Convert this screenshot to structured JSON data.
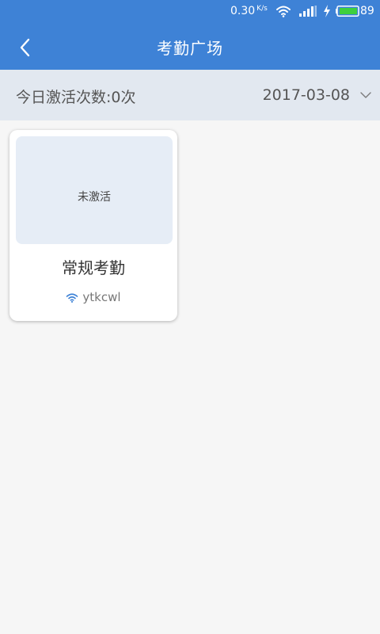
{
  "status_bar": {
    "speed": "0.30",
    "speed_unit": "K/s",
    "battery": "89",
    "icons": [
      "wifi-icon",
      "signal-icon",
      "charging-icon",
      "battery-icon"
    ]
  },
  "header": {
    "title": "考勤广场",
    "back_icon": "chevron-left-icon"
  },
  "filter": {
    "activation_count_label": "今日激活次数:0次",
    "date": "2017-03-08",
    "dropdown_icon": "chevron-down-icon"
  },
  "cards": [
    {
      "status": "未激活",
      "title": "常规考勤",
      "wifi_icon": "wifi-icon",
      "wifi_name": "ytkcwl"
    }
  ],
  "colors": {
    "header_bg": "#3e82d6",
    "filter_bg": "#e2e8f0",
    "card_status_bg": "#e6edf6",
    "page_bg": "#f6f6f6"
  }
}
